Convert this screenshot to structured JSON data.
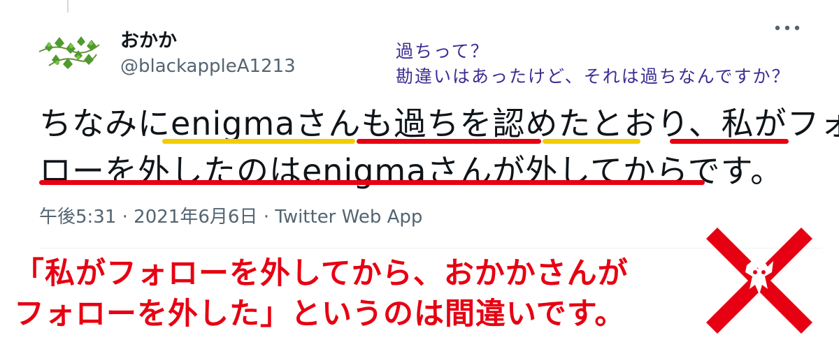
{
  "tweet": {
    "author": {
      "display_name": "おかか",
      "handle": "@blackappleA1213"
    },
    "body_lines": [
      "ちなみにenigmaさんも過ちを認めたとおり、私がフォ",
      "ローを外したのはenigmaさんが外してからです。"
    ],
    "timestamp": "午後5:31 · 2021年6月6日",
    "separator": " · ",
    "source": "Twitter Web App"
  },
  "annotation": {
    "lines": [
      "過ちって？",
      "勘違いはあったけど、それは過ちなんですか？"
    ],
    "color": "#3b2e92"
  },
  "caption": {
    "lines": [
      "「私がフォローを外してから、おかかさんが",
      "フォローを外した」というのは間違いです。"
    ],
    "color": "#e60012"
  },
  "icons": {
    "avatar": "green-leaves-avatar",
    "more": "more-options-icon",
    "cross": "red-x-mark-icon"
  },
  "colors": {
    "underline_yellow": "#f2cc00",
    "underline_red": "#e60012",
    "secondary_text": "#536471"
  }
}
